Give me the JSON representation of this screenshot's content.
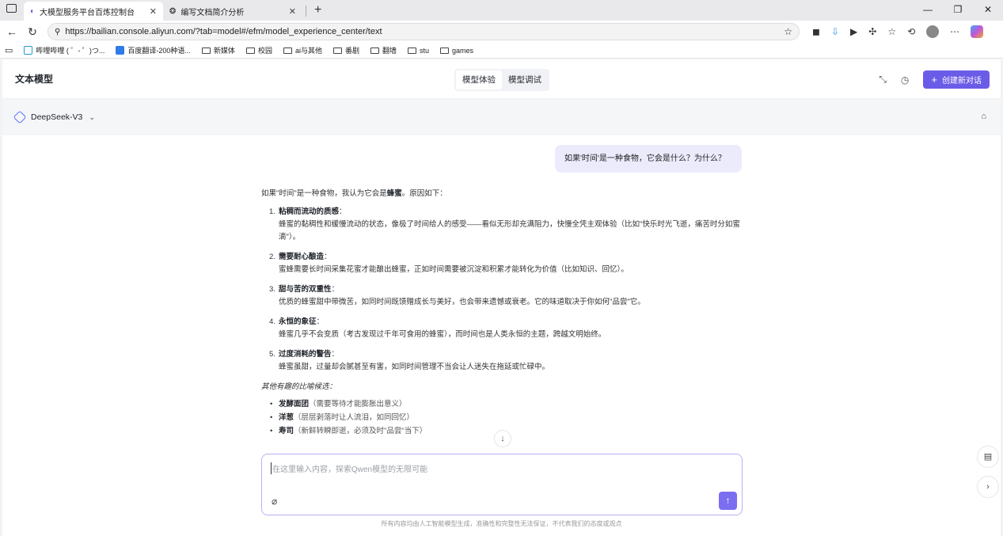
{
  "browser": {
    "tabs": [
      {
        "title": "大模型服务平台百炼控制台",
        "active": true
      },
      {
        "title": "编写文档简介分析",
        "active": false
      }
    ],
    "url": "https://bailian.console.aliyun.com/?tab=model#/efm/model_experience_center/text",
    "bookmarks": [
      {
        "label": "哔哩哔哩 ( ゜- ゜)つ...",
        "icon": "bilibili-icon"
      },
      {
        "label": "百度翻译-200种语...",
        "icon": "translate-icon"
      },
      {
        "label": "新媒体",
        "icon": "folder-icon"
      },
      {
        "label": "校园",
        "icon": "folder-icon"
      },
      {
        "label": "ai与其他",
        "icon": "folder-icon"
      },
      {
        "label": "番剧",
        "icon": "folder-icon"
      },
      {
        "label": "翻墙",
        "icon": "folder-icon"
      },
      {
        "label": "stu",
        "icon": "folder-icon"
      },
      {
        "label": "games",
        "icon": "folder-icon"
      }
    ]
  },
  "header": {
    "title": "文本模型",
    "tabs": [
      "模型体验",
      "模型调试"
    ],
    "new_chat": "创建新对话"
  },
  "model": {
    "name": "DeepSeek-V3"
  },
  "chat": {
    "user_message": "如果'时间'是一种食物，它会是什么？为什么？",
    "intro_prefix": "如果\"时间\"是一种食物，我认为它会是",
    "intro_bold": "蜂蜜",
    "intro_suffix": "。原因如下：",
    "items": [
      {
        "num": "1.",
        "title": "粘稠而流动的质感",
        "body": "蜂蜜的黏稠性和缓慢流动的状态，像极了时间给人的感受——看似无形却充满阻力，快慢全凭主观体验（比如\"快乐时光飞逝，痛苦时分如蜜滴\"）。"
      },
      {
        "num": "2.",
        "title": "需要耐心酿造",
        "body": "蜜蜂需要长时间采集花蜜才能酿出蜂蜜，正如时间需要被沉淀和积累才能转化为价值（比如知识、回忆）。"
      },
      {
        "num": "3.",
        "title": "甜与苦的双重性",
        "body": "优质的蜂蜜甜中带微苦，如同时间既馈赠成长与美好，也会带来遗憾或衰老。它的味道取决于你如何\"品尝\"它。"
      },
      {
        "num": "4.",
        "title": "永恒的象征",
        "body": "蜂蜜几乎不会变质（考古发现过千年可食用的蜂蜜），而时间也是人类永恒的主题，跨越文明始终。"
      },
      {
        "num": "5.",
        "title": "过度消耗的警告",
        "body": "蜂蜜虽甜，过量却会腻甚至有害，如同时间管理不当会让人迷失在拖延或忙碌中。"
      }
    ],
    "alt_title": "其他有趣的比喻候选",
    "alternatives": [
      {
        "bold": "发酵面团",
        "note": "（需要等待才能膨胀出意义）"
      },
      {
        "bold": "洋葱",
        "note": "（层层剥落时让人流泪，如同回忆）"
      },
      {
        "bold": "寿司",
        "note": "（新鲜转瞬即逝，必须及时\"品尝\"当下）"
      }
    ]
  },
  "input": {
    "placeholder": "在这里输入内容，探索Qwen模型的无限可能"
  },
  "footer": {
    "disclaimer": "所有内容均由人工智能模型生成，准确性和完整性无法保证，不代表我们的态度或观点"
  },
  "colors": {
    "accent": "#6b5ce7",
    "user_bubble": "#ecebfc"
  }
}
